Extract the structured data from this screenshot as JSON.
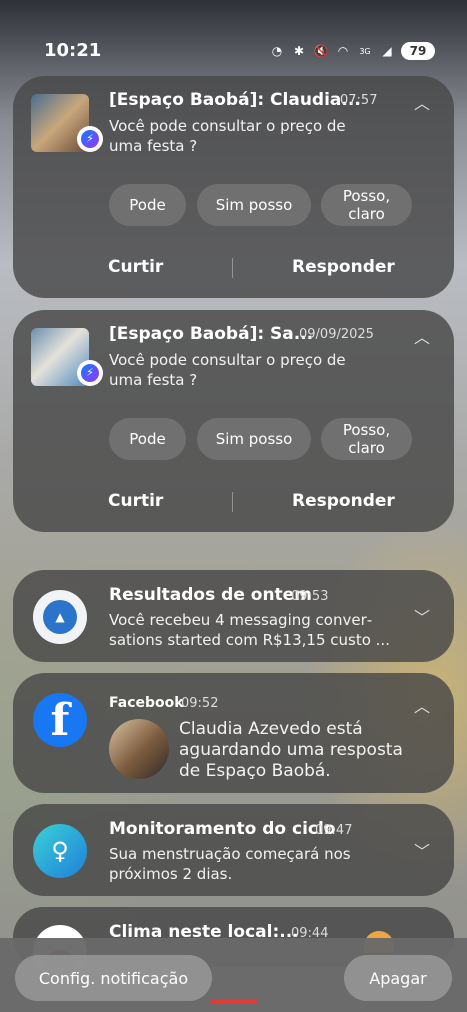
{
  "status_bar": {
    "time": "10:21",
    "battery": "79",
    "network_label": "3G",
    "icons": [
      "data-saver-icon",
      "bluetooth-icon",
      "mute-icon",
      "wifi-icon",
      "mobile-data-icon",
      "signal-icon",
      "battery-icon"
    ]
  },
  "notifications": [
    {
      "app": "Messenger",
      "title": "[Espaço Baobá]: Claudia...",
      "time": "07:57",
      "body": "Você pode consultar o preço de uma festa ?",
      "chips": [
        "Pode",
        "Sim posso",
        "Posso, claro"
      ],
      "actions": [
        "Curtir",
        "Responder"
      ],
      "chevron": "up"
    },
    {
      "app": "Messenger",
      "title": "[Espaço Baobá]: Sa...",
      "time": "09/09/2025",
      "body": "Você pode consultar o preço de uma festa ?",
      "chips": [
        "Pode",
        "Sim posso",
        "Posso, claro"
      ],
      "actions": [
        "Curtir",
        "Responder"
      ],
      "chevron": "up"
    },
    {
      "app": "Meta Ads",
      "title": "Resultados de ontem",
      "time": "09:53",
      "body": "Você recebeu 4 messaging conver­sations started com R$13,15 custo ...",
      "chevron": "down"
    },
    {
      "app": "Facebook",
      "title": "Facebook",
      "time": "09:52",
      "body": "Claudia Azevedo está aguardando uma resposta de Espaço Baobá.",
      "chevron": "up"
    },
    {
      "app": "Samsung Health",
      "title": "Monitoramento do ciclo",
      "time": "09:47",
      "body": "Sua menstruação começará nos próximos 2 dias.",
      "chevron": "down"
    },
    {
      "app": "Weather",
      "title": "Clima neste local:...",
      "time": "09:44"
    }
  ],
  "bottom": {
    "settings_label": "Config. notificação",
    "clear_label": "Apagar"
  },
  "colors": {
    "card_bg": "#484848",
    "facebook_blue": "#1877f2",
    "home_indicator": "#e53935"
  }
}
